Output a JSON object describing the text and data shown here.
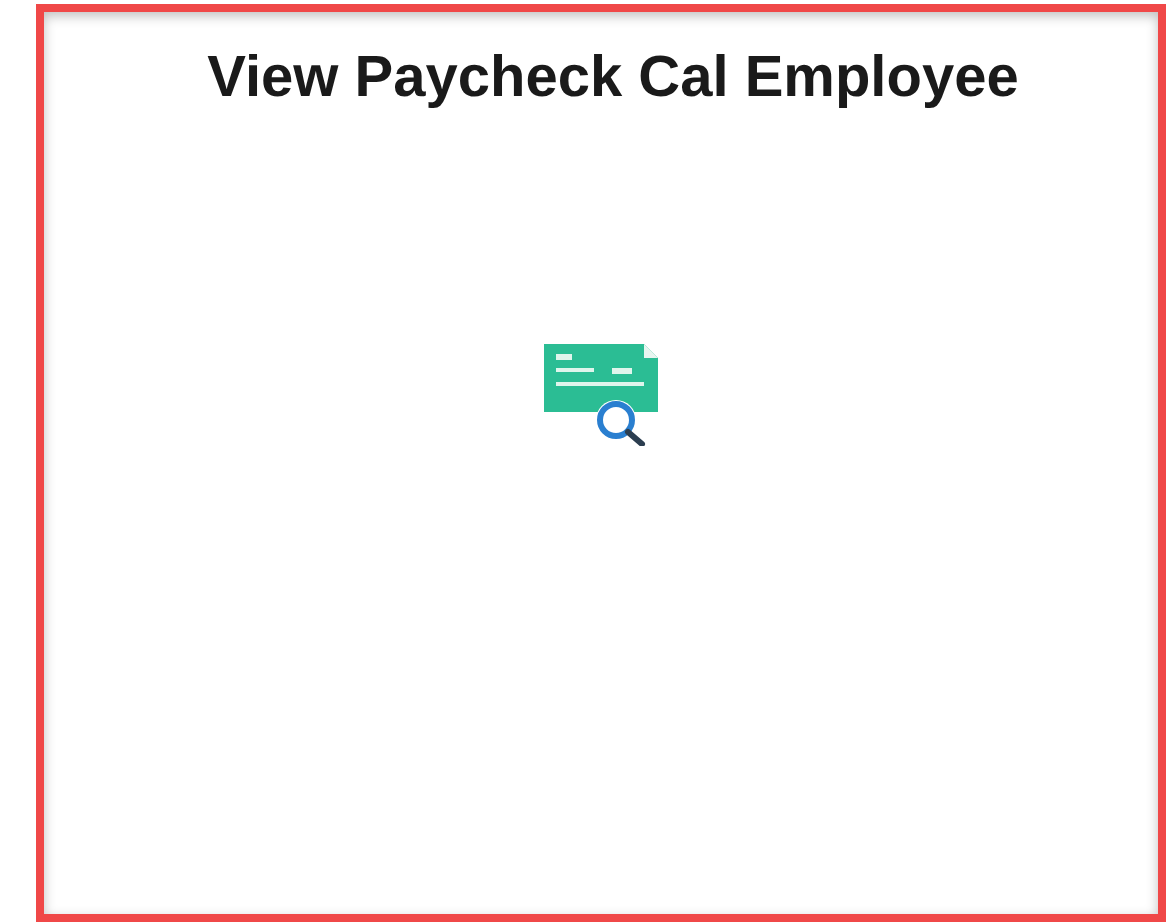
{
  "tile": {
    "title": "View Paycheck Cal Employee"
  }
}
